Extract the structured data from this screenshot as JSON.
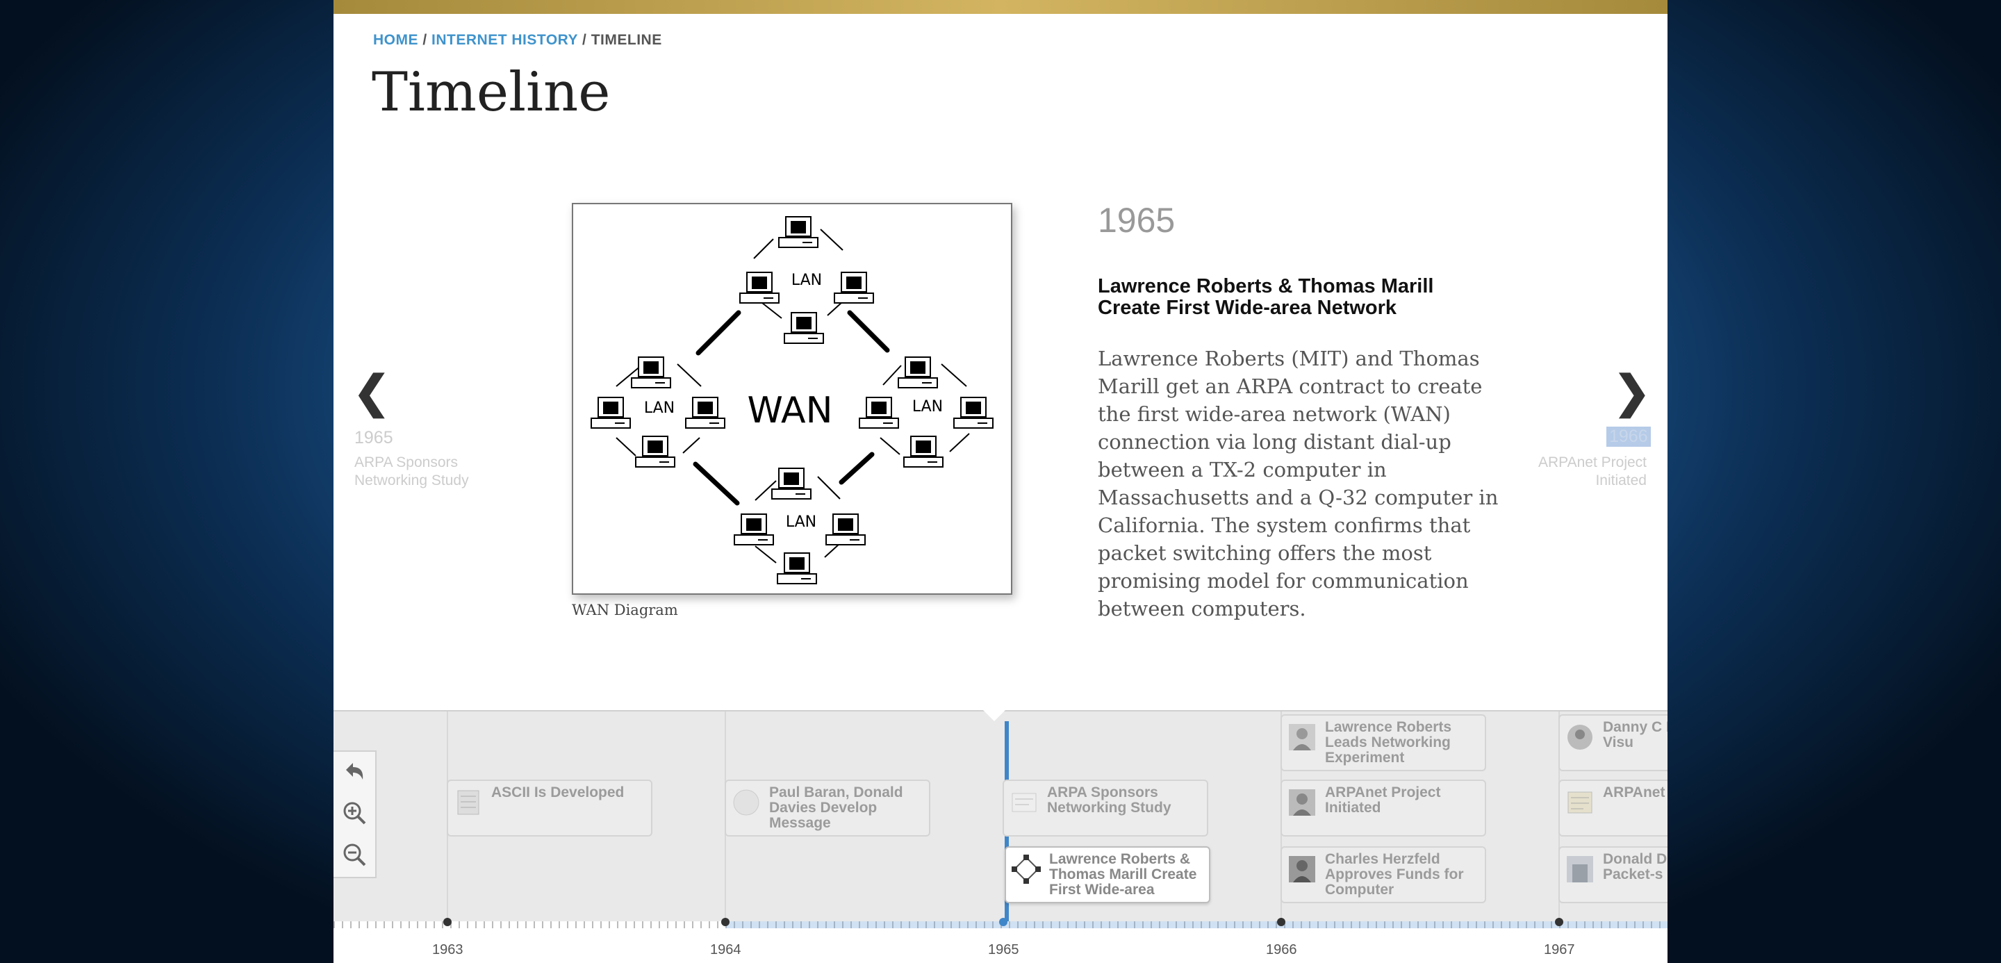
{
  "breadcrumb": {
    "home": "HOME",
    "section": "INTERNET HISTORY",
    "current": "TIMELINE",
    "sep": "/"
  },
  "page": {
    "title": "Timeline"
  },
  "slide": {
    "year": "1965",
    "headline": "Lawrence Roberts & Thomas Marill Create First Wide-area Network",
    "description": "Lawrence Roberts (MIT) and Thomas Marill get an ARPA contract to create the first wide-area network (WAN) connection via long distant dial-up between a TX-2 computer in Massachusetts and a Q-32 computer in California. The system confirms that packet switching offers the most promising model for communication between computers.",
    "caption": "WAN Diagram",
    "diagram": {
      "center": "WAN",
      "node": "LAN"
    }
  },
  "nav": {
    "prev": {
      "arrow": "❮",
      "year": "1965",
      "title": "ARPA Sponsors Networking Study"
    },
    "next": {
      "arrow": "❯",
      "year": "1966",
      "title": "ARPAnet Project Initiated"
    }
  },
  "timeline": {
    "events": [
      {
        "title": "ASCII Is Developed"
      },
      {
        "title": "Paul Baran, Donald Davies Develop Message"
      },
      {
        "title": "ARPA Sponsors Networking Study"
      },
      {
        "title": "Lawrence Roberts & Thomas Marill Create First Wide-area"
      },
      {
        "title": "Lawrence Roberts Leads Networking Experiment"
      },
      {
        "title": "ARPAnet Project Initiated"
      },
      {
        "title": "Charles Herzfeld Approves Funds for Computer"
      },
      {
        "title": "Danny C Develop time Visu"
      },
      {
        "title": "ARPAnet Begins"
      },
      {
        "title": "Donald D Publishe Packet-s"
      }
    ],
    "axis_labels": [
      "1963",
      "1964",
      "1965",
      "1966",
      "1967"
    ]
  },
  "colors": {
    "accent": "#3f86c9",
    "link": "#3f93cc",
    "gold": "#c9a955"
  },
  "icons": {
    "back": "back-arrow-icon",
    "zoom_in": "zoom-in-icon",
    "zoom_out": "zoom-out-icon"
  }
}
